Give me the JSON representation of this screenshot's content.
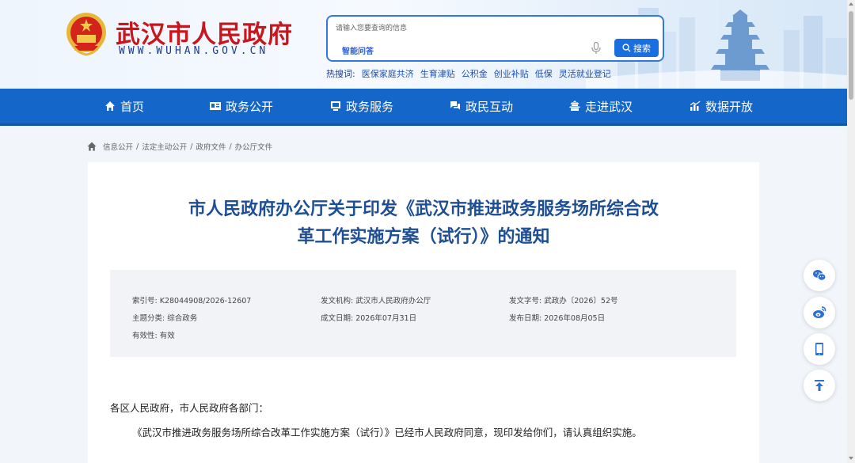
{
  "header": {
    "site_name": "武汉市人民政府",
    "domain": "WWW.WUHAN.GOV.CN",
    "brand_red": "#c8161d"
  },
  "search": {
    "placeholder": "请输入您要查询的信息",
    "tag": "智能问答",
    "button_label": "搜索"
  },
  "hot_searches": {
    "label": "热搜词:",
    "items": [
      "医保家庭共济",
      "生育津贴",
      "公积金",
      "创业补贴",
      "低保",
      "灵活就业登记"
    ]
  },
  "nav": {
    "color": "#1466c8",
    "items": [
      {
        "label": "首页",
        "icon": "home-icon"
      },
      {
        "label": "政务公开",
        "icon": "id-card-icon"
      },
      {
        "label": "政务服务",
        "icon": "service-icon"
      },
      {
        "label": "政民互动",
        "icon": "chat-icon"
      },
      {
        "label": "走进武汉",
        "icon": "building-icon"
      },
      {
        "label": "数据开放",
        "icon": "chart-icon"
      }
    ]
  },
  "breadcrumb": [
    "信息公开",
    "法定主动公开",
    "政府文件",
    "办公厅文件"
  ],
  "article": {
    "title_line1": "市人民政府办公厅关于印发《武汉市推进政务服务场所综合改",
    "title_line2": "革工作实施方案（试行）》的通知",
    "meta": {
      "index_no": "索引号:  K28044908/2026-12607",
      "issuer": "发文机构:  武汉市人民政府办公厅",
      "doc_no": "发文字号:  武政办〔2026〕52号",
      "category": "主题分类:  综合政务",
      "created": "成文日期:  2026年07月31日",
      "published": "发布日期:  2026年08月05日",
      "validity": "有效性:  有效"
    },
    "salutation": "各区人民政府，市人民政府各部门：",
    "paragraph1": "《武汉市推进政务服务场所综合改革工作实施方案（试行）》已经市人民政府同意，现印发给你们，请认真组织实施。"
  },
  "side_tools": [
    "wechat-icon",
    "weibo-icon",
    "mobile-icon",
    "back-to-top-icon"
  ]
}
